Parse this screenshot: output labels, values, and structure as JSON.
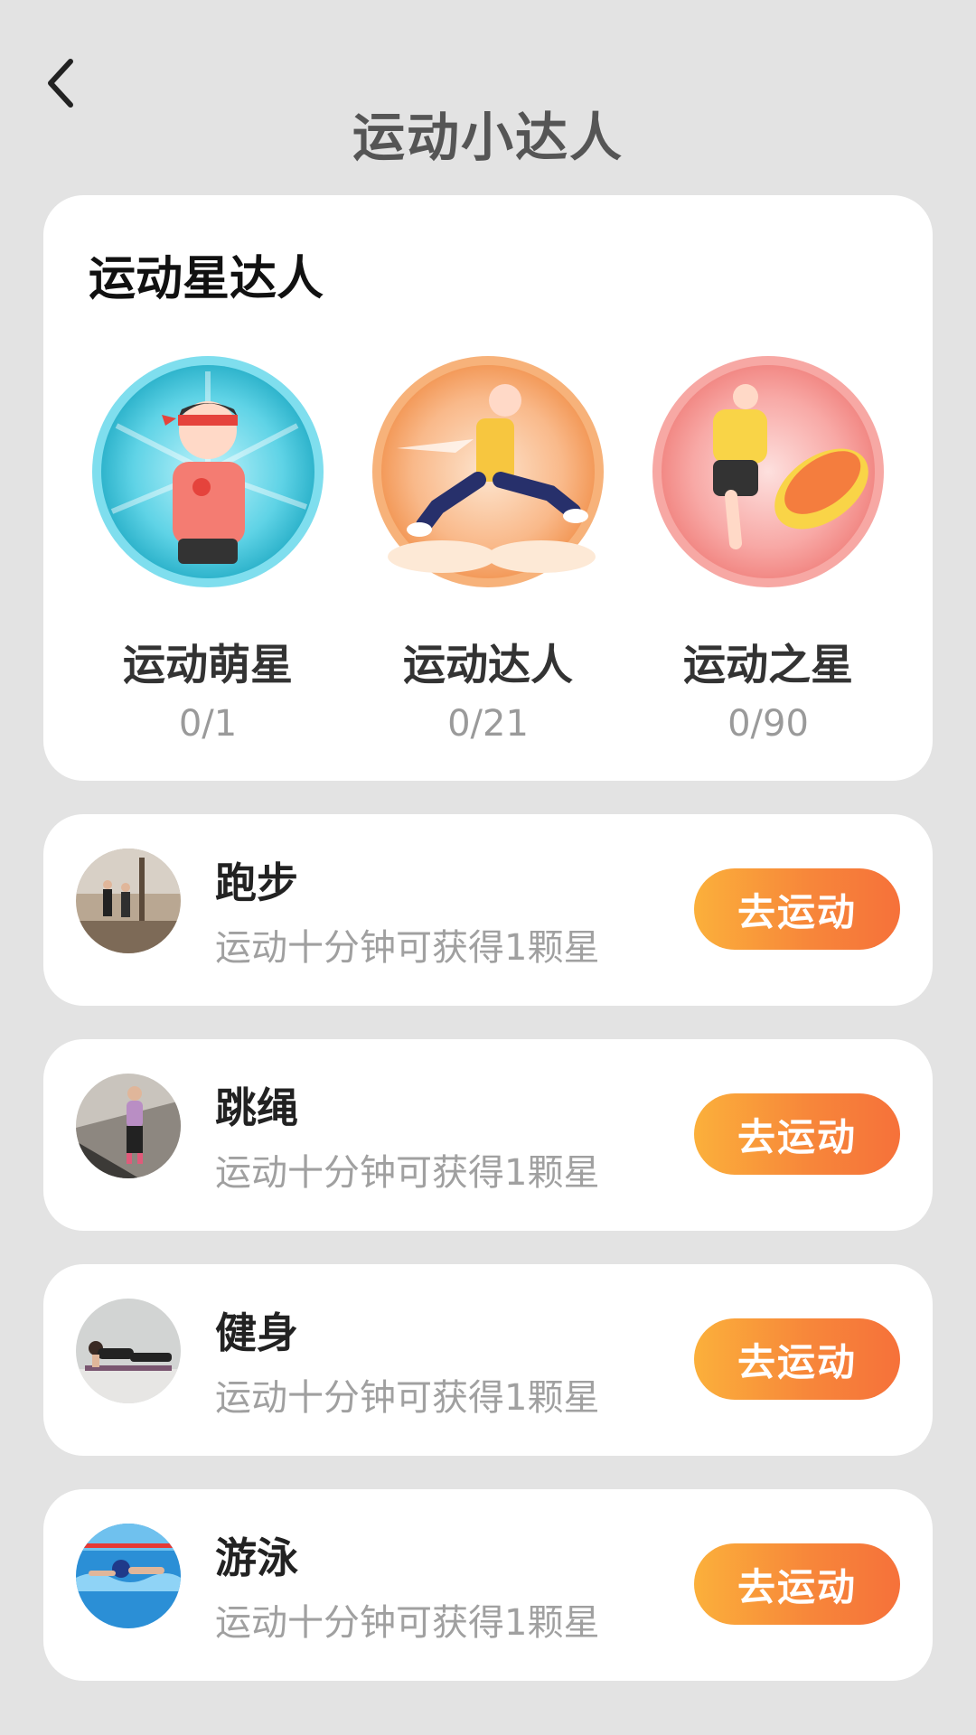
{
  "header": {
    "title": "运动小达人"
  },
  "stars_section": {
    "title": "运动星达人",
    "badges": [
      {
        "name": "运动萌星",
        "progress": "0/1",
        "color": "#45c9dd"
      },
      {
        "name": "运动达人",
        "progress": "0/21",
        "color": "#f8a866"
      },
      {
        "name": "运动之星",
        "progress": "0/90",
        "color": "#f7999a"
      }
    ]
  },
  "sports": [
    {
      "name": "跑步",
      "desc": "运动十分钟可获得1颗星",
      "button": "去运动"
    },
    {
      "name": "跳绳",
      "desc": "运动十分钟可获得1颗星",
      "button": "去运动"
    },
    {
      "name": "健身",
      "desc": "运动十分钟可获得1颗星",
      "button": "去运动"
    },
    {
      "name": "游泳",
      "desc": "运动十分钟可获得1颗星",
      "button": "去运动"
    }
  ],
  "colors": {
    "accent_start": "#fbb03b",
    "accent_end": "#f6713a",
    "background": "#e3e3e3"
  }
}
